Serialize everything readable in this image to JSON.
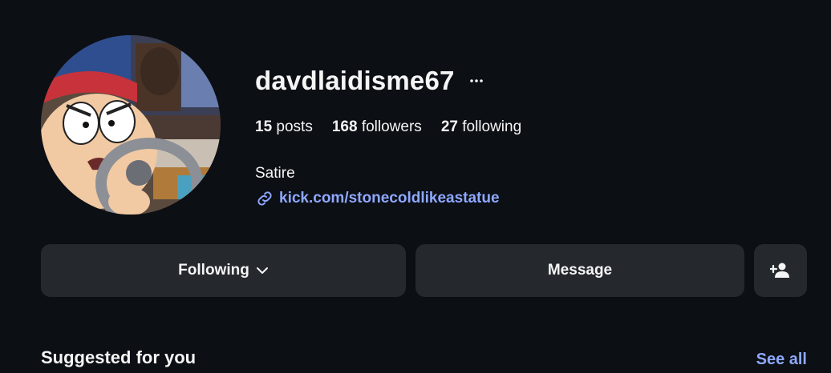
{
  "profile": {
    "username": "davdlaidisme67",
    "bio": "Satire",
    "link": "kick.com/stonecoldlikeastatue"
  },
  "stats": {
    "posts_count": "15",
    "posts_label": "posts",
    "followers_count": "168",
    "followers_label": "followers",
    "following_count": "27",
    "following_label": "following"
  },
  "actions": {
    "following_label": "Following",
    "message_label": "Message"
  },
  "suggested": {
    "title": "Suggested for you",
    "see_all_label": "See all"
  },
  "icons": {
    "more": "more-horizontal-icon",
    "link": "link-icon",
    "chevron": "chevron-down-icon",
    "add_user": "add-user-icon"
  },
  "colors": {
    "background": "#0c0f14",
    "button": "#25292e",
    "link": "#8ea8ff"
  }
}
